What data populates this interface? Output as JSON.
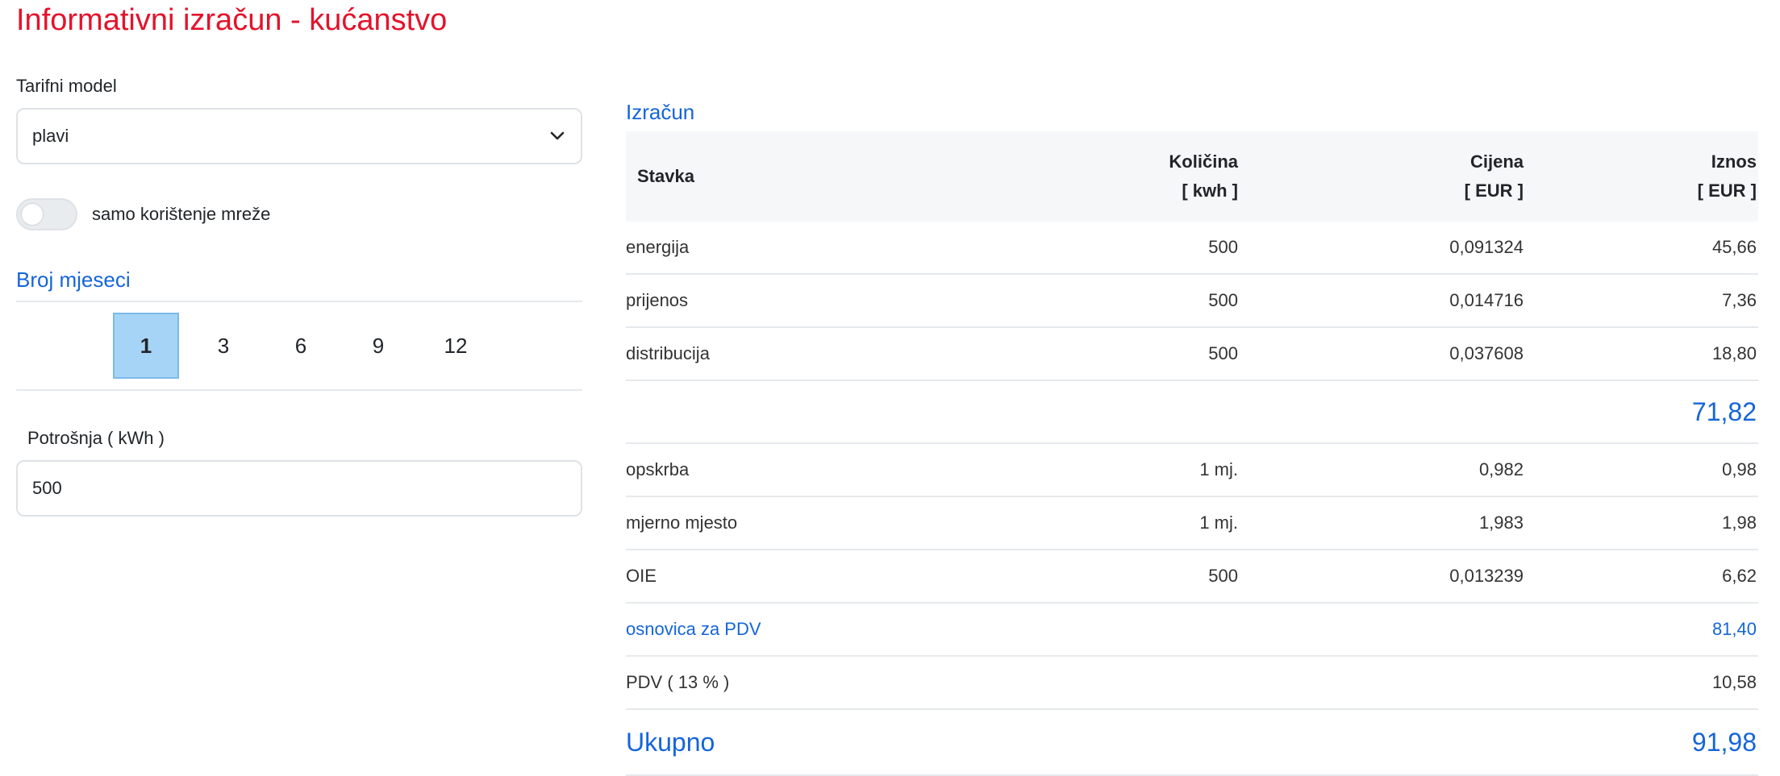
{
  "page_title": "Informativni izračun - kućanstvo",
  "tariff": {
    "label": "Tarifni model",
    "value": "plavi"
  },
  "network_toggle": {
    "label": "samo korištenje mreže",
    "on": false
  },
  "months": {
    "title": "Broj mjeseci",
    "options": [
      "1",
      "3",
      "6",
      "9",
      "12"
    ],
    "selected": "1"
  },
  "consumption": {
    "label": "Potrošnja ( kWh )",
    "value": "500"
  },
  "calc": {
    "title": "Izračun",
    "headers": {
      "item": "Stavka",
      "qty": "Količina",
      "qty_unit": "[ kwh ]",
      "price": "Cijena",
      "price_unit": "[ EUR ]",
      "amount": "Iznos",
      "amount_unit": "[ EUR ]"
    },
    "energy_rows": [
      {
        "item": "energija",
        "qty": "500",
        "price": "0,091324",
        "amount": "45,66"
      },
      {
        "item": "prijenos",
        "qty": "500",
        "price": "0,014716",
        "amount": "7,36"
      },
      {
        "item": "distribucija",
        "qty": "500",
        "price": "0,037608",
        "amount": "18,80"
      }
    ],
    "subtotal": "71,82",
    "fee_rows": [
      {
        "item": "opskrba",
        "qty": "1 mj.",
        "price": "0,982",
        "amount": "0,98"
      },
      {
        "item": "mjerno mjesto",
        "qty": "1 mj.",
        "price": "1,983",
        "amount": "1,98"
      },
      {
        "item": "OIE",
        "qty": "500",
        "price": "0,013239",
        "amount": "6,62"
      }
    ],
    "vat_base": {
      "label": "osnovica za PDV",
      "amount": "81,40"
    },
    "vat": {
      "label": "PDV ( 13 % )",
      "amount": "10,58"
    },
    "total": {
      "label": "Ukupno",
      "amount": "91,98"
    }
  },
  "colors": {
    "title_red": "#e3132c",
    "accent_blue": "#1565d8",
    "selected_month_bg": "#a6d4f6"
  },
  "icons": {
    "select_arrow": "chevron-down-icon"
  }
}
